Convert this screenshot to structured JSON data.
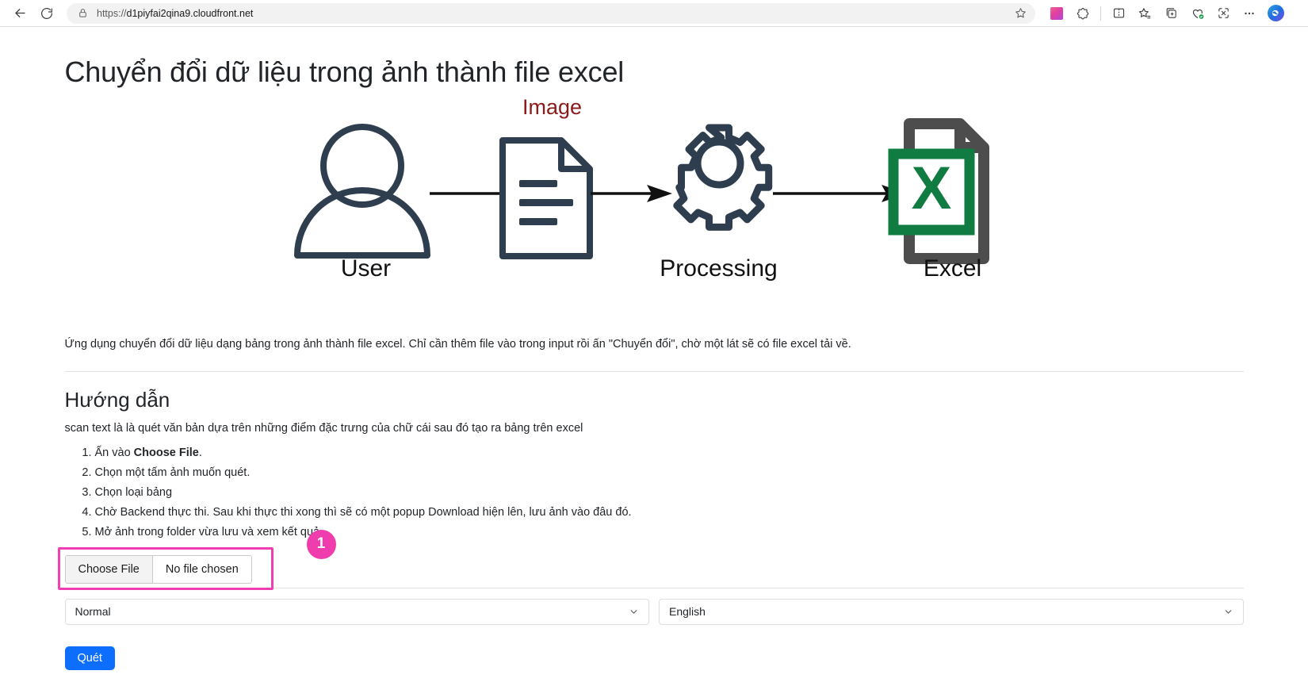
{
  "browser": {
    "back_icon": "back-arrow-icon",
    "refresh_icon": "refresh-icon",
    "lock_icon": "lock-icon",
    "url_scheme": "https://",
    "url_host": "d1piyfai2qina9.cloudfront.net",
    "favorite_icon": "star-icon",
    "toolbar_icons": [
      "color-swatch-icon",
      "browser-essentials-icon",
      "split-screen-icon",
      "add-favorite-icon",
      "collections-icon",
      "shopping-icon",
      "screenshot-icon",
      "more-options-icon",
      "copilot-icon"
    ]
  },
  "page": {
    "title": "Chuyển đổi dữ liệu trong ảnh thành file excel",
    "diagram": {
      "user_label": "User",
      "image_label": "Image",
      "processing_label": "Processing",
      "excel_label": "Excel",
      "excel_letter": "X",
      "icon_color": "#2f3e4e",
      "image_label_color": "#8b1a1a",
      "excel_green": "#107c41",
      "excel_gray": "#4d4d4d"
    },
    "intro": "Ứng dụng chuyển đổi dữ liệu dạng bảng trong ảnh thành file excel. Chỉ cần thêm file vào trong input rồi ấn \"Chuyển đổi\", chờ một lát sẽ có file excel tải về.",
    "section_title": "Hướng dẫn",
    "section_sub": "scan text là là quét văn bản dựa trên những điểm đặc trưng của chữ cái sau đó tạo ra bảng trên excel",
    "steps": [
      {
        "prefix": "Ấn vào ",
        "bold": "Choose File",
        "suffix": "."
      },
      {
        "prefix": "Chọn một tấm ảnh muốn quét.",
        "bold": "",
        "suffix": ""
      },
      {
        "prefix": "Chọn loại bảng",
        "bold": "",
        "suffix": ""
      },
      {
        "prefix": "Chờ Backend thực thi. Sau khi thực thi xong thì sẽ có một popup Download hiện lên, lưu ảnh vào đâu đó.",
        "bold": "",
        "suffix": ""
      },
      {
        "prefix": "Mở ảnh trong folder vừa lưu và xem kết quả.",
        "bold": "",
        "suffix": ""
      }
    ],
    "form": {
      "choose_file_label": "Choose File",
      "no_file_label": "No file chosen",
      "annotation_badge": "1",
      "annotation_color": "#ef3dad",
      "mode_select_value": "Normal",
      "language_select_value": "English",
      "chevron_icon": "chevron-down-icon",
      "submit_label": "Quét",
      "submit_color": "#0d6efd"
    }
  }
}
